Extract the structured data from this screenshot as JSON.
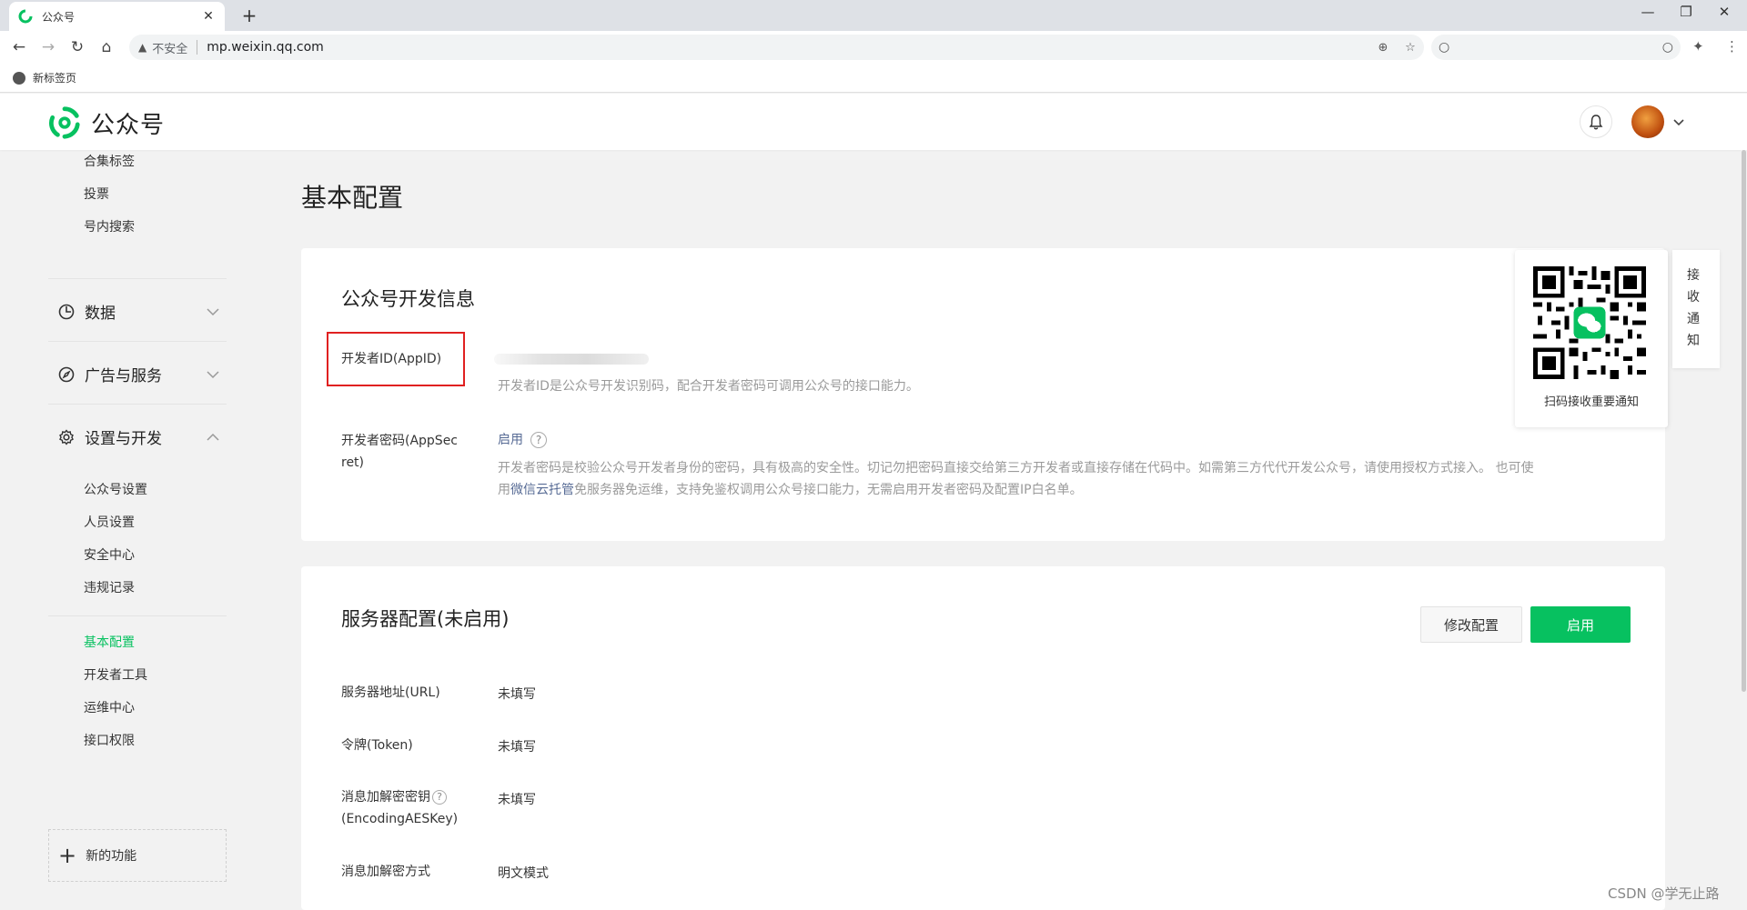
{
  "browser": {
    "tab_title": "公众号",
    "tab_close": "✕",
    "new_tab": "+",
    "insecure_label": "不安全",
    "url": "mp.weixin.qq.com",
    "bookmark_label": "新标签页"
  },
  "header": {
    "brand": "公众号"
  },
  "sidebar": {
    "top_items": [
      "合集标签",
      "投票",
      "号内搜索"
    ],
    "groups": {
      "data": "数据",
      "ads": "广告与服务",
      "settings": "设置与开发"
    },
    "settings_items": [
      "公众号设置",
      "人员设置",
      "安全中心",
      "违规记录"
    ],
    "dev_items": [
      "基本配置",
      "开发者工具",
      "运维中心",
      "接口权限"
    ],
    "new_feature": "新的功能"
  },
  "main": {
    "page_title": "基本配置",
    "dev_info": {
      "title": "公众号开发信息",
      "appid_label": "开发者ID(AppID)",
      "appid_desc": "开发者ID是公众号开发识别码，配合开发者密码可调用公众号的接口能力。",
      "secret_label_1": "开发者密码(AppSec",
      "secret_label_2": "ret)",
      "secret_action": "启用",
      "secret_desc_1": "开发者密码是校验公众号开发者身份的密码，具有极高的安全性。切记勿把密码直接交给第三方开发者或直接存储在代码中。如需第三方代代开发公众号，请使用授权方式接入。 也可使",
      "secret_desc_2a": "用",
      "secret_desc_link": "微信云托管",
      "secret_desc_2b": "免服务器免运维，支持免鉴权调用公众号接口能力，无需启用开发者密码及配置IP白名单。"
    },
    "server": {
      "title": "服务器配置(未启用)",
      "modify_button": "修改配置",
      "enable_button": "启用",
      "url_label": "服务器地址(URL)",
      "url_value": "未填写",
      "token_label": "令牌(Token)",
      "token_value": "未填写",
      "aes_label_1": "消息加解密密钥",
      "aes_label_2": "(EncodingAESKey)",
      "aes_value": "未填写",
      "mode_label": "消息加解密方式",
      "mode_value": "明文模式"
    }
  },
  "notice": {
    "qr_caption": "扫码接收重要通知",
    "side_tab": "接收通知"
  },
  "watermark": "CSDN @学无止路",
  "colors": {
    "brand_green": "#07c160",
    "link_blue": "#576b95",
    "highlight_red": "#e02020"
  }
}
